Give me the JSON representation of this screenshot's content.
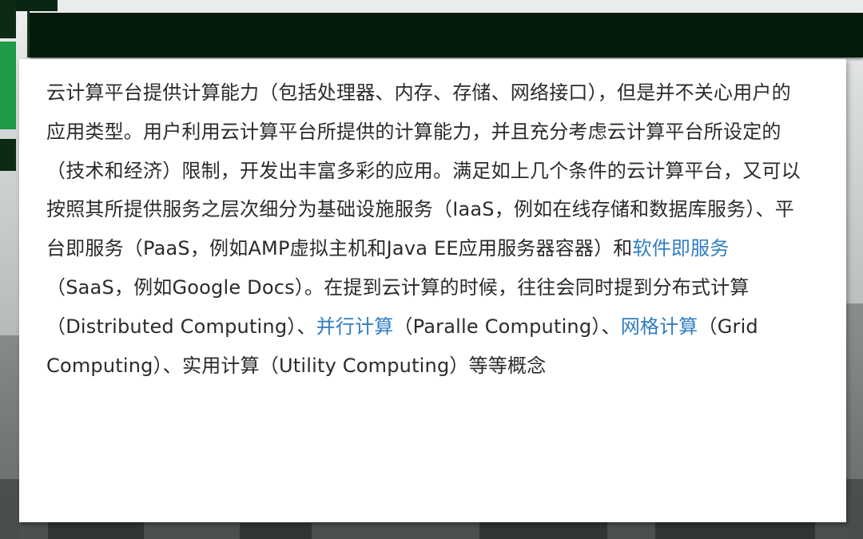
{
  "body": {
    "text_1": "云计算平台提供计算能力（包括处理器、内存、存储、网络接口），但是并不关心用户的应用类型。用户利用云计算平台所提供的计算能力，并且充分考虑云计算平台所设定的（技术和经济）限制，开发出丰富多彩的应用。满足如上几个条件的云计算平台，又可以按照其所提供服务之层次细分为基础设施服务（IaaS，例如在线存储和数据库服务）、平台即服务（PaaS，例如AMP虚拟主机和Java EE应用服务器容器）和",
    "link_saas": "软件即服务",
    "text_2": "（SaaS，例如Google Docs）。在提到云计算的时候，往往会同时提到分布式计算（Distributed Computing）、",
    "link_parallel": "并行计算",
    "text_3": "（Paralle Computing）、",
    "link_grid": "网格计算",
    "text_4": "（Grid Computing）、实用计算（Utility Computing）等等概念"
  },
  "colors": {
    "header": "#041a0b",
    "accent_green": "#1f9a45",
    "link": "#2f7ec1",
    "text": "#2b2b2b"
  }
}
